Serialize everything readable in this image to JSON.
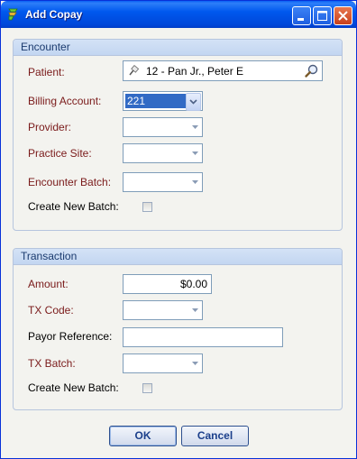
{
  "window": {
    "title": "Add Copay"
  },
  "encounter": {
    "group_title": "Encounter",
    "patient_label": "Patient:",
    "patient_value": "12 - Pan Jr., Peter E",
    "billing_account_label": "Billing Account:",
    "billing_account_value": "221",
    "provider_label": "Provider:",
    "provider_value": "",
    "practice_site_label": "Practice Site:",
    "practice_site_value": "",
    "encounter_batch_label": "Encounter Batch:",
    "encounter_batch_value": "",
    "create_new_batch_label": "Create New Batch:",
    "create_new_batch_checked": false
  },
  "transaction": {
    "group_title": "Transaction",
    "amount_label": "Amount:",
    "amount_value": "$0.00",
    "tx_code_label": "TX Code:",
    "tx_code_value": "",
    "payor_reference_label": "Payor Reference:",
    "payor_reference_value": "",
    "tx_batch_label": "TX Batch:",
    "tx_batch_value": "",
    "create_new_batch_label": "Create New Batch:",
    "create_new_batch_checked": false
  },
  "buttons": {
    "ok": "OK",
    "cancel": "Cancel"
  },
  "colors": {
    "titlebar": "#0058ee",
    "required_label": "#7a1a1a",
    "group_header": "#c3d6f1",
    "selection": "#316ac5"
  },
  "icons": [
    "app-icon",
    "minimize-icon",
    "maximize-icon",
    "close-icon",
    "pin-icon",
    "magnifier-icon",
    "chevron-down-icon"
  ]
}
